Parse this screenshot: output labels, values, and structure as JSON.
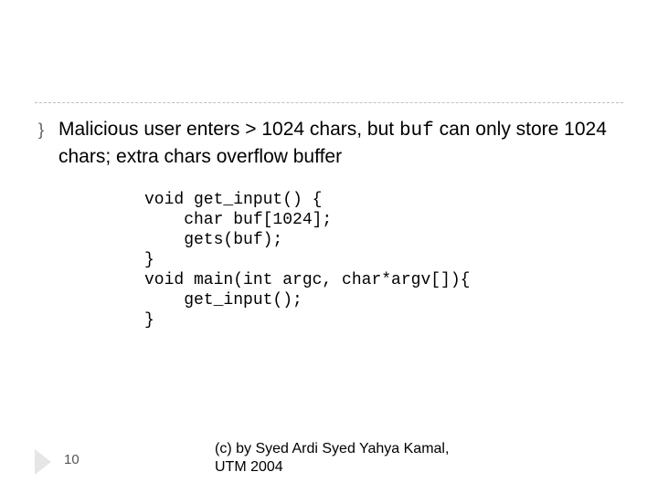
{
  "bullet": {
    "text_before": "Malicious user enters > 1024 chars, but ",
    "code_word": "buf",
    "text_after": " can only store 1024 chars; extra chars overflow buffer"
  },
  "code": "void get_input() {\n    char buf[1024];\n    gets(buf);\n}\nvoid main(int argc, char*argv[]){\n    get_input();\n}",
  "page_number": "10",
  "copyright": "(c) by Syed Ardi Syed Yahya Kamal, UTM 2004"
}
